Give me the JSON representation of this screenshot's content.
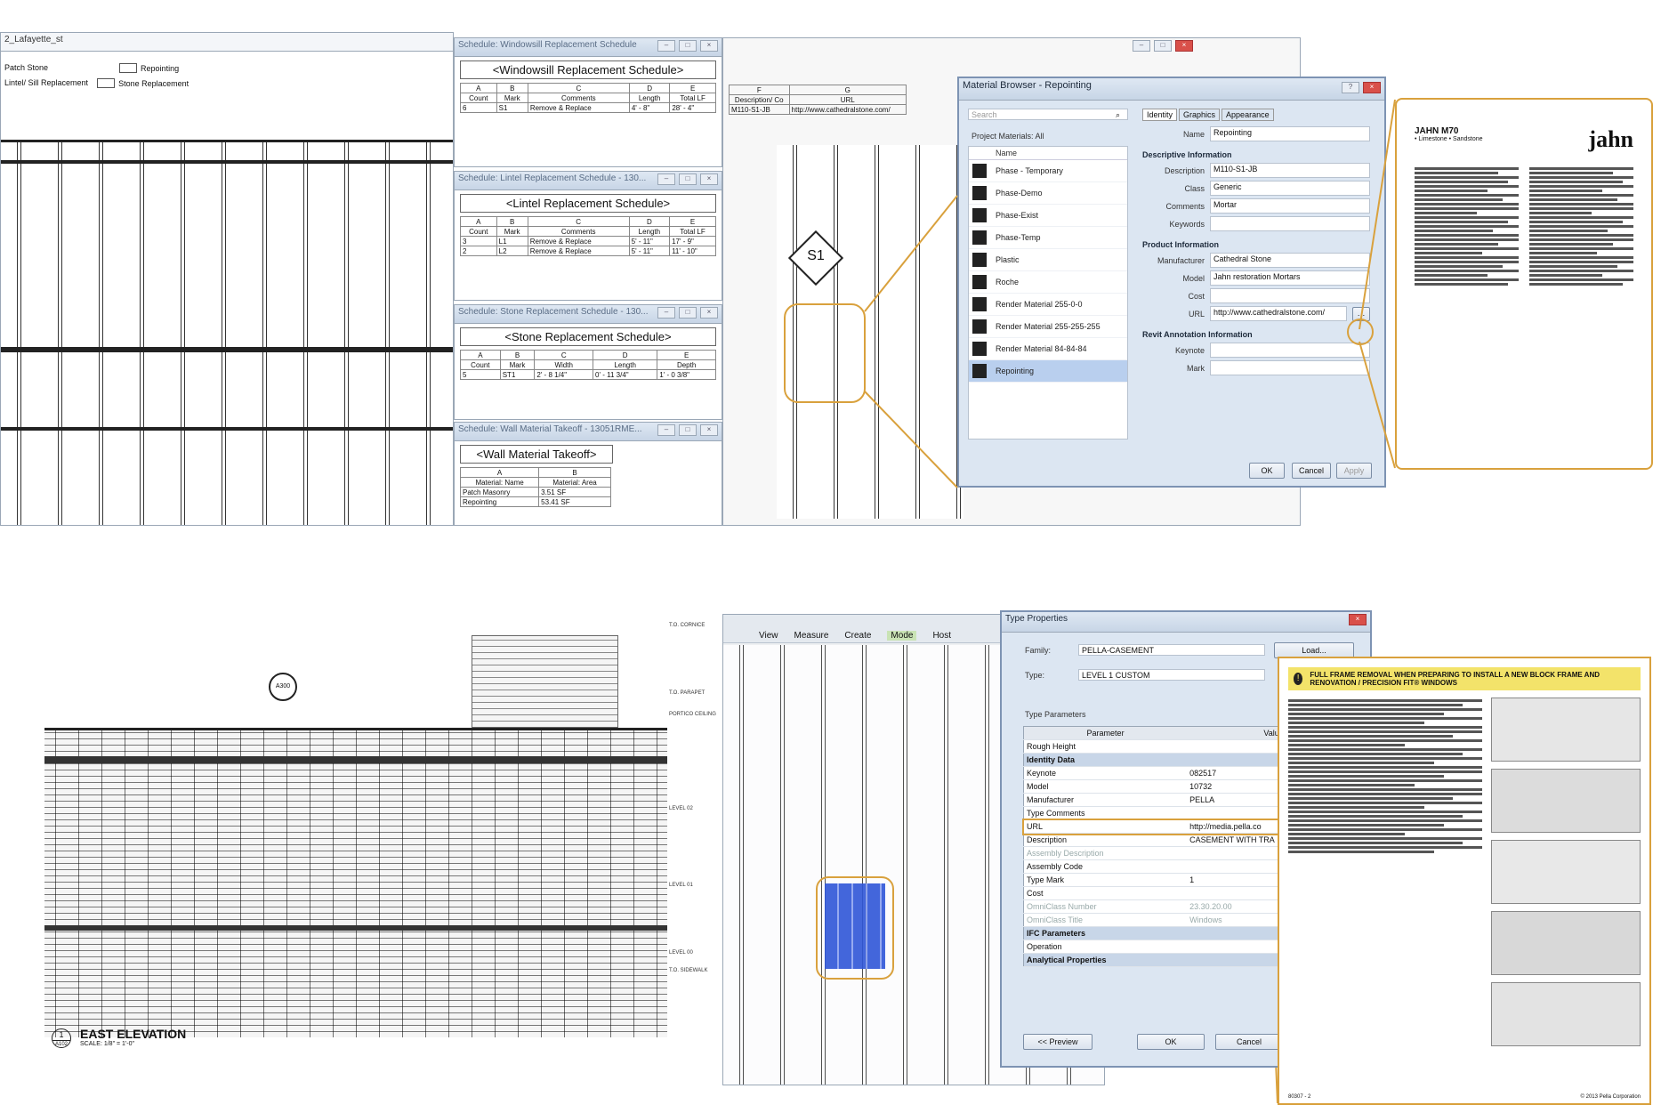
{
  "top": {
    "left_pane": {
      "title": "2_Lafayette_st",
      "legend": [
        "Patch Stone",
        "Repointing",
        "Lintel/ Sill Replacement",
        "Stone Replacement"
      ]
    },
    "schedules": [
      {
        "window_title": "Schedule: Windowsill Replacement Schedule",
        "heading": "<Windowsill Replacement Schedule>",
        "letters": [
          "A",
          "B",
          "C",
          "D",
          "E"
        ],
        "headers": [
          "Count",
          "Mark",
          "Comments",
          "Length",
          "Total LF"
        ],
        "rows": [
          [
            "6",
            "S1",
            "Remove & Replace",
            "4' - 8\"",
            "28' - 4\""
          ]
        ]
      },
      {
        "window_title": "Schedule: Lintel Replacement Schedule - 130...",
        "heading": "<Lintel Replacement Schedule>",
        "letters": [
          "A",
          "B",
          "C",
          "D",
          "E"
        ],
        "headers": [
          "Count",
          "Mark",
          "Comments",
          "Length",
          "Total LF"
        ],
        "rows": [
          [
            "3",
            "L1",
            "Remove & Replace",
            "5' - 11\"",
            "17' - 9\""
          ],
          [
            "2",
            "L2",
            "Remove & Replace",
            "5' - 11\"",
            "11' - 10\""
          ]
        ]
      },
      {
        "window_title": "Schedule: Stone Replacement Schedule - 130...",
        "heading": "<Stone Replacement Schedule>",
        "letters": [
          "A",
          "B",
          "C",
          "D",
          "E"
        ],
        "headers": [
          "Count",
          "Mark",
          "Width",
          "Length",
          "Depth"
        ],
        "rows": [
          [
            "5",
            "ST1",
            "2' - 8 1/4\"",
            "0' - 11 3/4\"",
            "1' - 0 3/8\""
          ]
        ]
      },
      {
        "window_title": "Schedule: Wall Material Takeoff - 13051RME...",
        "heading": "<Wall Material Takeoff>",
        "letters": [
          "A",
          "B"
        ],
        "headers": [
          "Material: Name",
          "Material: Area"
        ],
        "rows": [
          [
            "Patch Masonry",
            "3.51 SF"
          ],
          [
            "Repointing",
            "53.41 SF"
          ]
        ]
      }
    ],
    "mini_table": {
      "letters": [
        "F",
        "G"
      ],
      "headers": [
        "Description/ Co",
        "URL"
      ],
      "row": [
        "M110-S1-JB",
        "http://www.cathedralstone.com/"
      ]
    },
    "view_tag": "S1",
    "material_browser": {
      "title": "Material Browser - Repointing",
      "search_placeholder": "Search",
      "filter": "Project Materials: All",
      "name_header": "Name",
      "materials": [
        "Phase - Temporary",
        "Phase-Demo",
        "Phase-Exist",
        "Phase-Temp",
        "Plastic",
        "Roche",
        "Render Material 255-0-0",
        "Render Material 255-255-255",
        "Render Material 84-84-84",
        "Repointing"
      ],
      "selected": "Repointing",
      "tabs": [
        "Identity",
        "Graphics",
        "Appearance"
      ],
      "name_label": "Name",
      "name_value": "Repointing",
      "descriptive_header": "Descriptive Information",
      "descriptive": [
        [
          "Description",
          "M110-S1-JB"
        ],
        [
          "Class",
          "Generic"
        ],
        [
          "Comments",
          "Mortar"
        ],
        [
          "Keywords",
          ""
        ]
      ],
      "product_header": "Product Information",
      "product": [
        [
          "Manufacturer",
          "Cathedral Stone"
        ],
        [
          "Model",
          "Jahn restoration Mortars"
        ],
        [
          "Cost",
          ""
        ],
        [
          "URL",
          "http://www.cathedralstone.com/"
        ]
      ],
      "annotation_header": "Revit Annotation Information",
      "annotation": [
        [
          "Keynote",
          ""
        ],
        [
          "Mark",
          ""
        ]
      ],
      "buttons": [
        "OK",
        "Cancel",
        "Apply"
      ]
    },
    "datasheet": {
      "brand": "jahn",
      "title": "JAHN M70",
      "subtitle": "• Limestone • Sandstone"
    }
  },
  "bottom": {
    "elevation": {
      "title": "EAST ELEVATION",
      "scale": "SCALE: 1/8\" = 1'-0\"",
      "sheet_ref": "A102",
      "callout_num": "1",
      "levels": [
        "T.O. CORNICE",
        "T.O. PARAPET",
        "PORTICO CEILING",
        "LEVEL 02",
        "LEVEL 01",
        "LEVEL 00",
        "T.O. SIDEWALK"
      ],
      "section_tag": "A300"
    },
    "ribbon": {
      "items": [
        "View",
        "Measure",
        "Create",
        "Mode",
        "Host"
      ]
    },
    "type_properties": {
      "title": "Type Properties",
      "family_label": "Family:",
      "family": "PELLA-CASEMENT",
      "load": "Load...",
      "type_label": "Type:",
      "type": "LEVEL 1 CUSTOM",
      "params_label": "Type Parameters",
      "col_param": "Parameter",
      "col_value": "Value",
      "rows": [
        {
          "k": "Rough Height",
          "v": "",
          "kind": "row"
        },
        {
          "k": "Identity Data",
          "v": "",
          "kind": "sec"
        },
        {
          "k": "Keynote",
          "v": "082517",
          "kind": "row"
        },
        {
          "k": "Model",
          "v": "10732",
          "kind": "row"
        },
        {
          "k": "Manufacturer",
          "v": "PELLA",
          "kind": "row"
        },
        {
          "k": "Type Comments",
          "v": "",
          "kind": "row"
        },
        {
          "k": "URL",
          "v": "http://media.pella.co",
          "kind": "row"
        },
        {
          "k": "Description",
          "v": "CASEMENT WITH TRA",
          "kind": "row"
        },
        {
          "k": "Assembly Description",
          "v": "",
          "kind": "dim"
        },
        {
          "k": "Assembly Code",
          "v": "",
          "kind": "row"
        },
        {
          "k": "Type Mark",
          "v": "1",
          "kind": "row"
        },
        {
          "k": "Cost",
          "v": "",
          "kind": "row"
        },
        {
          "k": "OmniClass Number",
          "v": "23.30.20.00",
          "kind": "dim"
        },
        {
          "k": "OmniClass Title",
          "v": "Windows",
          "kind": "dim"
        },
        {
          "k": "IFC Parameters",
          "v": "",
          "kind": "sec"
        },
        {
          "k": "Operation",
          "v": "",
          "kind": "row"
        },
        {
          "k": "Analytical Properties",
          "v": "",
          "kind": "sec"
        }
      ],
      "preview": "<< Preview",
      "ok": "OK",
      "cancel": "Cancel"
    },
    "instruction_sheet": {
      "heading": "FULL FRAME REMOVAL WHEN PREPARING TO INSTALL A NEW BLOCK FRAME AND RENOVATION / PRECISION FIT® WINDOWS",
      "footer_left": "80307 - 2",
      "footer_right": "© 2013 Pella Corporation"
    }
  },
  "colors": {
    "callout": "#d9a13d",
    "selection_blue": "#2f56d8",
    "dialog_title": "#c9d8ec",
    "header_yellow": "#f3e36a"
  }
}
